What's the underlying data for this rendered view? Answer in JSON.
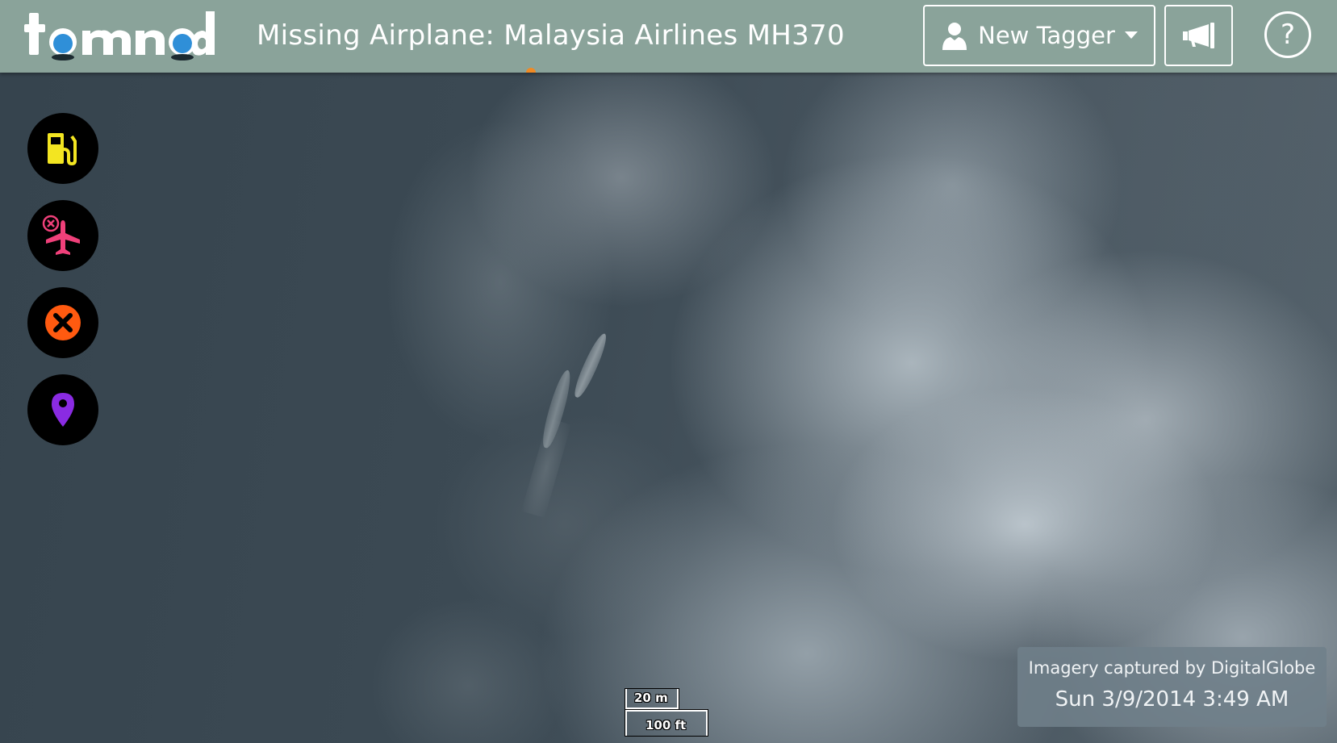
{
  "header": {
    "logo_text": "tomnod",
    "title": "Missing Airplane: Malaysia Airlines MH370",
    "user_button_label": "New Tagger",
    "help_label": "?"
  },
  "icons": {
    "user": "user-icon",
    "caret": "caret-down-icon",
    "announce": "megaphone-icon",
    "help": "question-icon"
  },
  "tools": [
    {
      "name": "fuel-tool-icon",
      "color": "#f3e521"
    },
    {
      "name": "airplane-wreckage-tool-icon",
      "color": "#f0407a"
    },
    {
      "name": "close-tool-icon",
      "color": "#ff5a10"
    },
    {
      "name": "location-pin-tool-icon",
      "color": "#8a2be2"
    }
  ],
  "scale": {
    "metric_label": "20 m",
    "imperial_label": "100 ft"
  },
  "imagery": {
    "credit": "Imagery captured by DigitalGlobe",
    "date": "Sun 3/9/2014 3:49 AM"
  },
  "colors": {
    "header_bg": "#8aa39a",
    "accent_orange": "#f08a24"
  }
}
